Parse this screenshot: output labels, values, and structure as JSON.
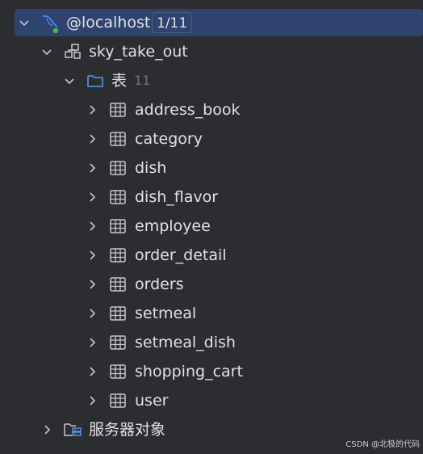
{
  "connection": {
    "label": "@localhost",
    "badge": "1/11",
    "icon": "mysql-dolphin-icon",
    "status_color": "#3fb950"
  },
  "schema": {
    "label": "sky_take_out",
    "icon": "schema-icon"
  },
  "tables_folder": {
    "label": "表",
    "count": "11",
    "icon": "folder-icon"
  },
  "tables": [
    {
      "label": "address_book"
    },
    {
      "label": "category"
    },
    {
      "label": "dish"
    },
    {
      "label": "dish_flavor"
    },
    {
      "label": "employee"
    },
    {
      "label": "order_detail"
    },
    {
      "label": "orders"
    },
    {
      "label": "setmeal"
    },
    {
      "label": "setmeal_dish"
    },
    {
      "label": "shopping_cart"
    },
    {
      "label": "user"
    }
  ],
  "server_objects": {
    "label": "服务器对象",
    "icon": "server-objects-icon"
  },
  "watermark": "CSDN @北极的代码",
  "colors": {
    "background": "#2b2d30",
    "selection": "#2e436e",
    "text": "#dfe1e5",
    "muted": "#6f737a",
    "accent": "#4a8fe7"
  }
}
